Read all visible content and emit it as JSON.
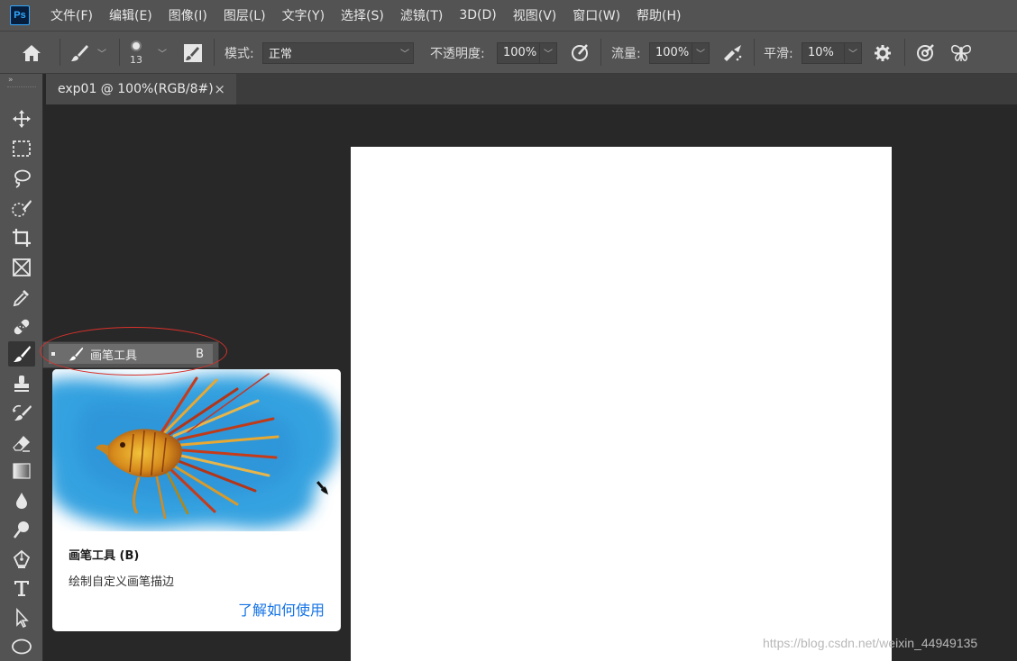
{
  "app": {
    "logo_text": "Ps"
  },
  "menu": [
    "文件(F)",
    "编辑(E)",
    "图像(I)",
    "图层(L)",
    "文字(Y)",
    "选择(S)",
    "滤镜(T)",
    "3D(D)",
    "视图(V)",
    "窗口(W)",
    "帮助(H)"
  ],
  "options": {
    "brush_size": "13",
    "mode_label": "模式:",
    "mode_value": "正常",
    "opacity_label": "不透明度:",
    "opacity_value": "100%",
    "flow_label": "流量:",
    "flow_value": "100%",
    "smooth_label": "平滑:",
    "smooth_value": "10%"
  },
  "document_tab": {
    "title": "exp01 @ 100%(RGB/8#)",
    "close": "×"
  },
  "flyout": {
    "label": "画笔工具",
    "shortcut": "B"
  },
  "tooltip": {
    "title": "画笔工具 (B)",
    "description": "绘制自定义画笔描边",
    "link": "了解如何使用"
  },
  "watermark": "https://blog.csdn.net/weixin_44949135",
  "colors": {
    "accent_link": "#1473e6",
    "annotation": "#d9312b",
    "ps_blue": "#31a8ff"
  }
}
